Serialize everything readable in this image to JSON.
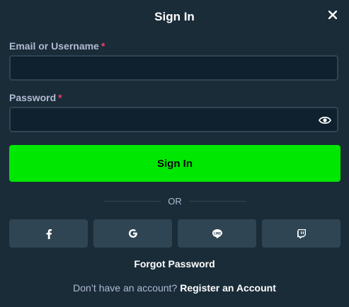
{
  "modal": {
    "title": "Sign In"
  },
  "form": {
    "email_label": "Email or Username",
    "email_required": "*",
    "email_value": "",
    "password_label": "Password",
    "password_required": "*",
    "password_value": "",
    "submit_label": "Sign In"
  },
  "divider": {
    "text": "OR"
  },
  "social": {
    "buttons": [
      {
        "icon": "facebook-icon"
      },
      {
        "icon": "google-icon"
      },
      {
        "icon": "line-icon"
      },
      {
        "icon": "twitch-icon"
      }
    ]
  },
  "footer": {
    "forgot_label": "Forgot Password",
    "register_prompt": "Don’t have an account?",
    "register_link": "Register an Account"
  },
  "colors": {
    "background": "#1a2c38",
    "input_bg": "#0f212e",
    "border": "#2f4553",
    "accent": "#00e701",
    "required": "#ed4163",
    "muted_text": "#b1bad3"
  }
}
